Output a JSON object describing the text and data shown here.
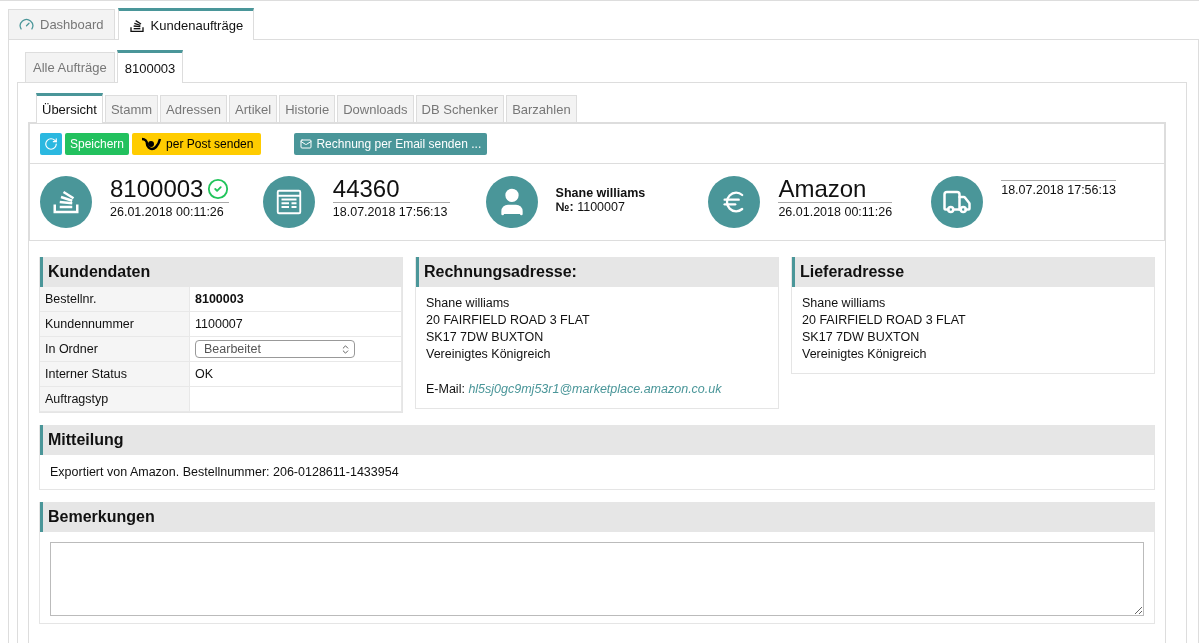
{
  "main_tabs": [
    {
      "label": "Dashboard",
      "kind": "dashboard",
      "selected": false
    },
    {
      "label": "Kundenaufträge",
      "kind": "orders",
      "selected": true
    }
  ],
  "order_tabs": [
    {
      "label": "Alle Aufträge",
      "selected": false
    },
    {
      "label": "8100003",
      "selected": true
    }
  ],
  "detail_tabs": [
    {
      "label": "Übersicht",
      "selected": true
    },
    {
      "label": "Stamm",
      "selected": false
    },
    {
      "label": "Adressen",
      "selected": false
    },
    {
      "label": "Artikel",
      "selected": false
    },
    {
      "label": "Historie",
      "selected": false
    },
    {
      "label": "Downloads",
      "selected": false
    },
    {
      "label": "DB Schenker",
      "selected": false
    },
    {
      "label": "Barzahlen",
      "selected": false
    }
  ],
  "toolbar": {
    "save": "Speichern",
    "post": "per Post senden",
    "email": "Rechnung per Email senden ..."
  },
  "summary": [
    {
      "kind": "order",
      "title": "8100003",
      "verified": true,
      "date": "26.01.2018 00:11:26"
    },
    {
      "kind": "invoice",
      "title": "44360",
      "date": "18.07.2018 17:56:13"
    },
    {
      "kind": "customer",
      "name": "Shane williams",
      "number_label": "№:",
      "number": "1100007"
    },
    {
      "kind": "payment",
      "title": "Amazon",
      "date": "26.01.2018 00:11:26"
    },
    {
      "kind": "shipping",
      "date": "18.07.2018 17:56:13"
    }
  ],
  "customer_data": {
    "title": "Kundendaten",
    "rows": [
      {
        "label": "Bestellnr.",
        "value": "8100003",
        "kind": "bold"
      },
      {
        "label": "Kundennummer",
        "value": "1100007",
        "kind": "text"
      },
      {
        "label": "In Ordner",
        "value": "Bearbeitet",
        "kind": "select"
      },
      {
        "label": "Interner Status",
        "value": "OK",
        "kind": "text"
      },
      {
        "label": "Auftragstyp",
        "kind": "text"
      }
    ]
  },
  "billing_address": {
    "title": "Rechnungsadresse:",
    "lines": [
      "Shane williams",
      "20 FAIRFIELD ROAD 3 FLAT",
      "SK17 7DW BUXTON",
      "Vereinigtes Königreich"
    ],
    "email_label": "E-Mail:",
    "email": "hl5sj0gc9mj53r1@marketplace.amazon.co.uk"
  },
  "delivery_address": {
    "title": "Lieferadresse",
    "lines": [
      "Shane williams",
      "20 FAIRFIELD ROAD 3 FLAT",
      "SK17 7DW BUXTON",
      "Vereinigtes Königreich"
    ]
  },
  "message": {
    "title": "Mitteilung",
    "text": "Exportiert von Amazon. Bestellnummer: 206-0128611-1433954"
  },
  "remarks": {
    "title": "Bemerkungen"
  }
}
